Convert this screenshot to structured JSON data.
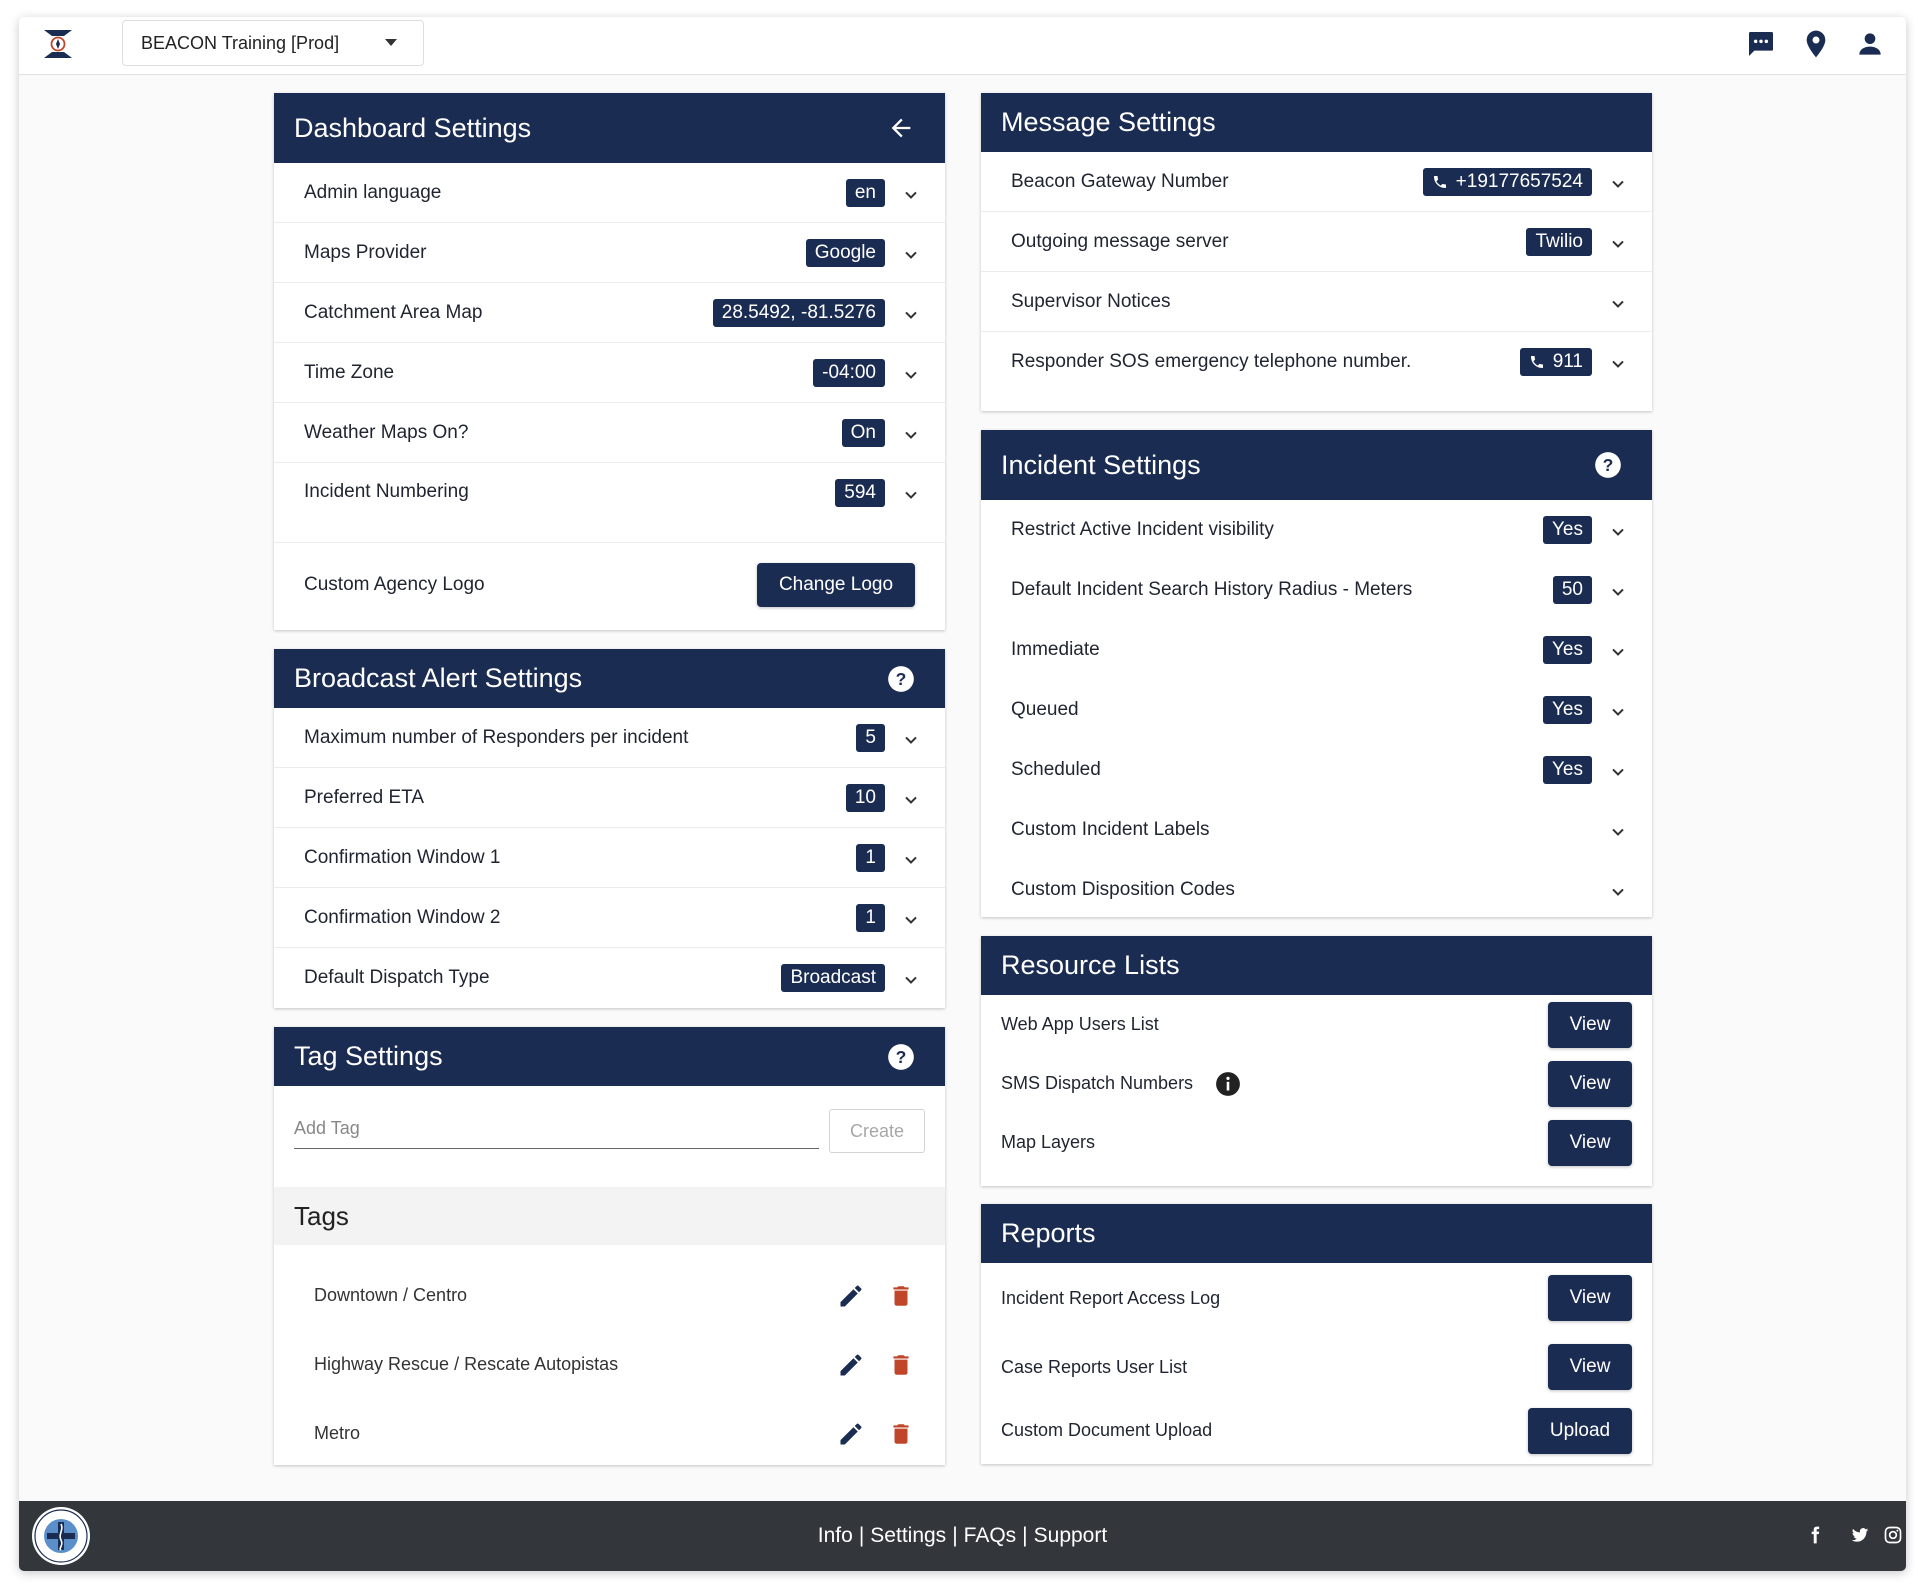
{
  "header": {
    "org_name": "BEACON Training [Prod]",
    "icons": [
      "app-logo-icon",
      "chat-icon",
      "location-pin-icon",
      "person-icon"
    ]
  },
  "dashboard": {
    "title": "Dashboard Settings",
    "rows": [
      {
        "label": "Admin language",
        "value": "en"
      },
      {
        "label": "Maps Provider",
        "value": "Google"
      },
      {
        "label": "Catchment Area Map",
        "value": "28.5492, -81.5276"
      },
      {
        "label": "Time Zone",
        "value": "-04:00"
      },
      {
        "label": "Weather Maps On?",
        "value": "On"
      },
      {
        "label": "Incident Numbering",
        "value": "594"
      }
    ],
    "logo_label": "Custom Agency Logo",
    "logo_button": "Change Logo"
  },
  "broadcast": {
    "title": "Broadcast Alert Settings",
    "rows": [
      {
        "label": "Maximum number of Responders per incident",
        "value": "5"
      },
      {
        "label": "Preferred ETA",
        "value": "10"
      },
      {
        "label": "Confirmation Window 1",
        "value": "1"
      },
      {
        "label": "Confirmation Window 2",
        "value": "1"
      },
      {
        "label": "Default Dispatch Type",
        "value": "Broadcast"
      }
    ]
  },
  "tags": {
    "title": "Tag Settings",
    "input_placeholder": "Add Tag",
    "create_label": "Create",
    "section_title": "Tags",
    "items": [
      "Downtown / Centro",
      "Highway Rescue / Rescate Autopistas",
      "Metro"
    ]
  },
  "message": {
    "title": "Message Settings",
    "rows": [
      {
        "label": "Beacon Gateway Number",
        "value": "+19177657524"
      },
      {
        "label": "Outgoing message server",
        "value": "Twilio"
      },
      {
        "label": "Supervisor Notices",
        "value": ""
      },
      {
        "label": "Responder SOS emergency telephone number.",
        "value": "911"
      }
    ]
  },
  "incident": {
    "title": "Incident Settings",
    "rows": [
      {
        "label": "Restrict Active Incident visibility",
        "value": "Yes"
      },
      {
        "label": "Default Incident Search History Radius - Meters",
        "value": "50"
      },
      {
        "label": "Immediate",
        "value": "Yes"
      },
      {
        "label": "Queued",
        "value": "Yes"
      },
      {
        "label": "Scheduled",
        "value": "Yes"
      },
      {
        "label": "Custom Incident Labels",
        "value": ""
      },
      {
        "label": "Custom Disposition Codes",
        "value": ""
      }
    ]
  },
  "resources": {
    "title": "Resource Lists",
    "rows": [
      {
        "label": "Web App Users List",
        "button": "View"
      },
      {
        "label": "SMS Dispatch Numbers",
        "button": "View"
      },
      {
        "label": "Map Layers",
        "button": "View"
      }
    ]
  },
  "reports": {
    "title": "Reports",
    "rows": [
      {
        "label": "Incident Report Access Log",
        "button": "View"
      },
      {
        "label": "Case Reports User List",
        "button": "View"
      },
      {
        "label": "Custom Document Upload",
        "button": "Upload"
      }
    ]
  },
  "footer": {
    "links": [
      "Info",
      "Settings",
      "FAQs",
      "Support"
    ],
    "separator": "|",
    "social_icons": [
      "facebook-icon",
      "twitter-icon",
      "instagram-icon"
    ]
  },
  "colors": {
    "navy": "#1b2c52",
    "footer_bg": "#33363a",
    "delete_red": "#c0462a"
  }
}
